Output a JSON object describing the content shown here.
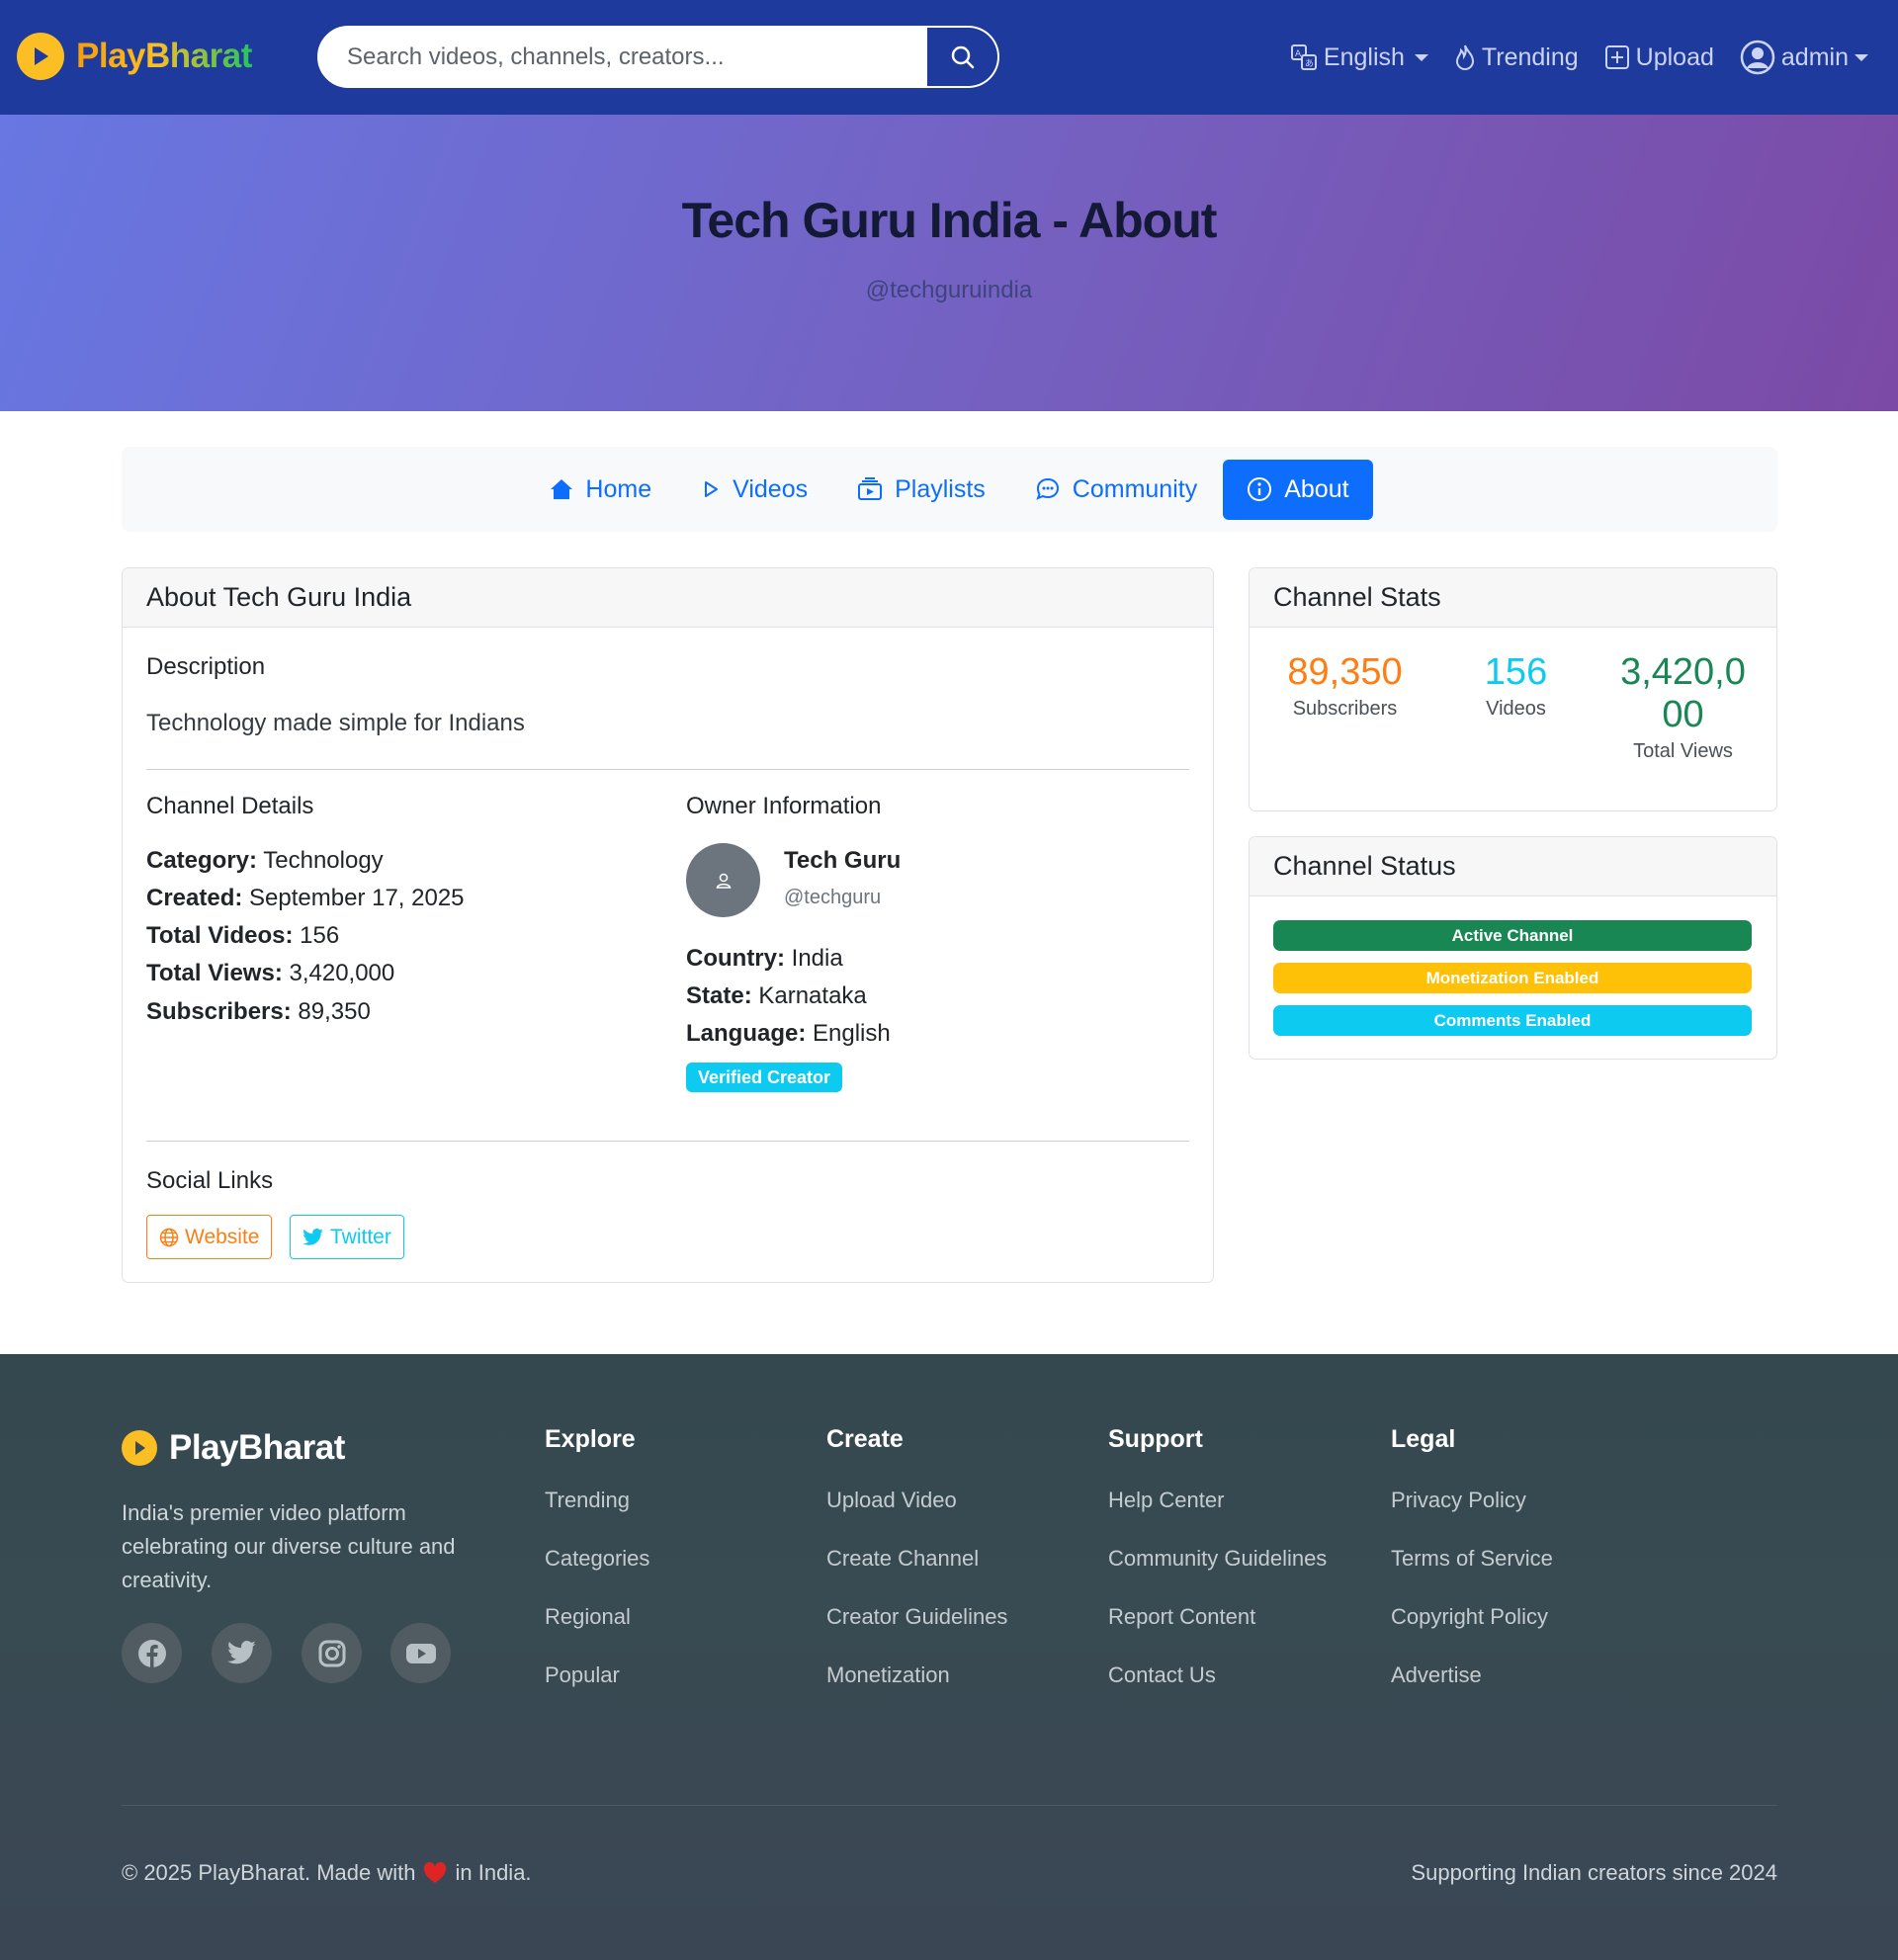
{
  "navbar": {
    "brand": "PlayBharat",
    "search_placeholder": "Search videos, channels, creators...",
    "language": "English",
    "trending": "Trending",
    "upload": "Upload",
    "user": "admin"
  },
  "hero": {
    "title": "Tech Guru India - About",
    "handle": "@techguruindia"
  },
  "tabs": [
    {
      "label": "Home",
      "icon": "house-icon"
    },
    {
      "label": "Videos",
      "icon": "play-icon"
    },
    {
      "label": "Playlists",
      "icon": "playlist-icon"
    },
    {
      "label": "Community",
      "icon": "chat-icon"
    },
    {
      "label": "About",
      "icon": "info-icon",
      "active": true
    }
  ],
  "about": {
    "header": "About Tech Guru India",
    "description_title": "Description",
    "description": "Technology made simple for Indians",
    "details_title": "Channel Details",
    "category_label": "Category:",
    "category": "Technology",
    "created_label": "Created:",
    "created": "September 17, 2025",
    "videos_label": "Total Videos:",
    "videos": "156",
    "views_label": "Total Views:",
    "views": "3,420,000",
    "subs_label": "Subscribers:",
    "subs": "89,350",
    "owner_title": "Owner Information",
    "owner_name": "Tech Guru",
    "owner_handle": "@techguru",
    "country_label": "Country:",
    "country": "India",
    "state_label": "State:",
    "state": "Karnataka",
    "language_label": "Language:",
    "language": "English",
    "verified_badge": "Verified Creator",
    "social_title": "Social Links",
    "website": "Website",
    "twitter": "Twitter"
  },
  "stats": {
    "header": "Channel Stats",
    "subscribers": "89,350",
    "subscribers_label": "Subscribers",
    "videos": "156",
    "videos_label": "Videos",
    "views_line1": "3,420,0",
    "views_line2": "00",
    "views_label": "Total Views"
  },
  "status": {
    "header": "Channel Status",
    "active": "Active Channel",
    "monetization": "Monetization Enabled",
    "comments": "Comments Enabled"
  },
  "footer": {
    "brand": "PlayBharat",
    "tagline": "India's premier video platform celebrating our diverse culture and creativity.",
    "columns": [
      {
        "title": "Explore",
        "links": [
          "Trending",
          "Categories",
          "Regional",
          "Popular"
        ]
      },
      {
        "title": "Create",
        "links": [
          "Upload Video",
          "Create Channel",
          "Creator Guidelines",
          "Monetization"
        ]
      },
      {
        "title": "Support",
        "links": [
          "Help Center",
          "Community Guidelines",
          "Report Content",
          "Contact Us"
        ]
      },
      {
        "title": "Legal",
        "links": [
          "Privacy Policy",
          "Terms of Service",
          "Copyright Policy",
          "Advertise"
        ]
      }
    ],
    "copyright_pre": "© 2025 PlayBharat. Made with",
    "copyright_post": "in India.",
    "since": "Supporting Indian creators since 2024"
  },
  "colors": {
    "navbar": "#1e3a9c",
    "primary": "#0d6efd",
    "orange": "#fd7e14",
    "info": "#0dcaf0",
    "success": "#198754",
    "warning": "#ffc107"
  }
}
